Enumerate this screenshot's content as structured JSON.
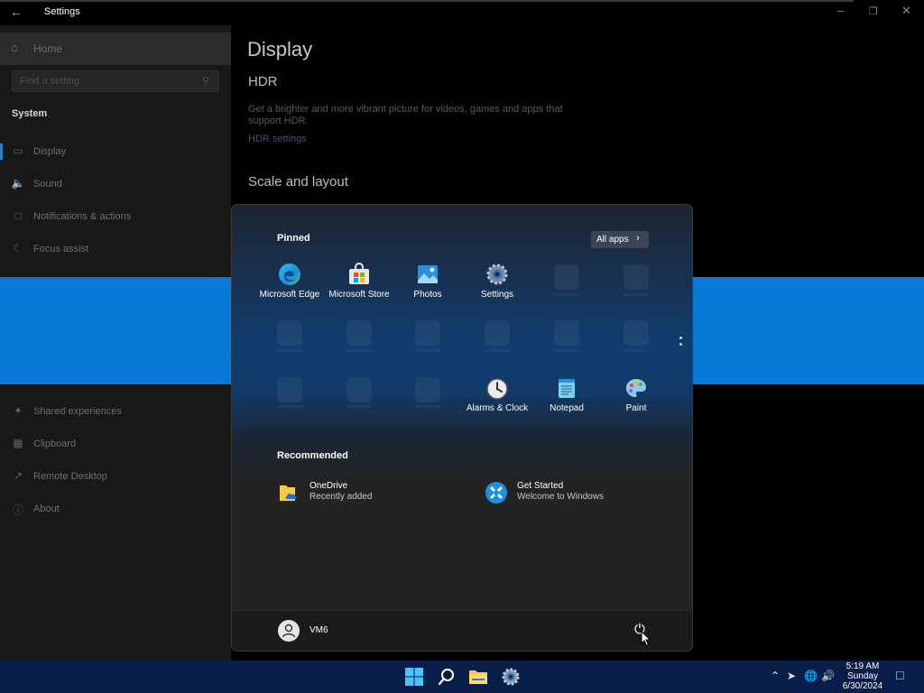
{
  "settings": {
    "window_title": "Settings",
    "home_label": "Home",
    "search_placeholder": "Find a setting",
    "section_label": "System",
    "nav_items": [
      {
        "label": "Display",
        "icon": "monitor-icon"
      },
      {
        "label": "Sound",
        "icon": "speaker-icon"
      },
      {
        "label": "Notifications & actions",
        "icon": "notification-icon"
      },
      {
        "label": "Focus assist",
        "icon": "moon-icon"
      },
      {
        "label": "Shared experiences",
        "icon": "shared-icon"
      },
      {
        "label": "Clipboard",
        "icon": "clipboard-icon"
      },
      {
        "label": "Remote Desktop",
        "icon": "remote-icon"
      },
      {
        "label": "About",
        "icon": "info-icon"
      }
    ],
    "page_title": "Display",
    "hdr_heading": "HDR",
    "hdr_description": "Get a brighter and more vibrant picture for videos, games and apps that support HDR.",
    "hdr_link": "HDR settings",
    "scale_heading": "Scale and layout"
  },
  "start_menu": {
    "pinned_heading": "Pinned",
    "all_apps_label": "All apps",
    "pinned_apps": [
      {
        "name": "Microsoft Edge",
        "icon": "edge-icon"
      },
      {
        "name": "Microsoft Store",
        "icon": "store-icon"
      },
      {
        "name": "Photos",
        "icon": "photos-icon"
      },
      {
        "name": "Settings",
        "icon": "settings-gear-icon"
      },
      {
        "name": "Alarms & Clock",
        "icon": "clock-icon"
      },
      {
        "name": "Notepad",
        "icon": "notepad-icon"
      },
      {
        "name": "Paint",
        "icon": "paint-icon"
      }
    ],
    "recommended_heading": "Recommended",
    "recommended": [
      {
        "title": "OneDrive",
        "subtitle": "Recently added",
        "icon": "onedrive-folder-icon"
      },
      {
        "title": "Get Started",
        "subtitle": "Welcome to Windows",
        "icon": "get-started-icon"
      }
    ],
    "user_name": "VM6"
  },
  "taskbar": {
    "time": "5:19 AM",
    "day": "Sunday",
    "date": "6/30/2024"
  },
  "colors": {
    "accent": "#0a78d6",
    "taskbar": "#0a1e4a",
    "start_bg": "#232323"
  }
}
